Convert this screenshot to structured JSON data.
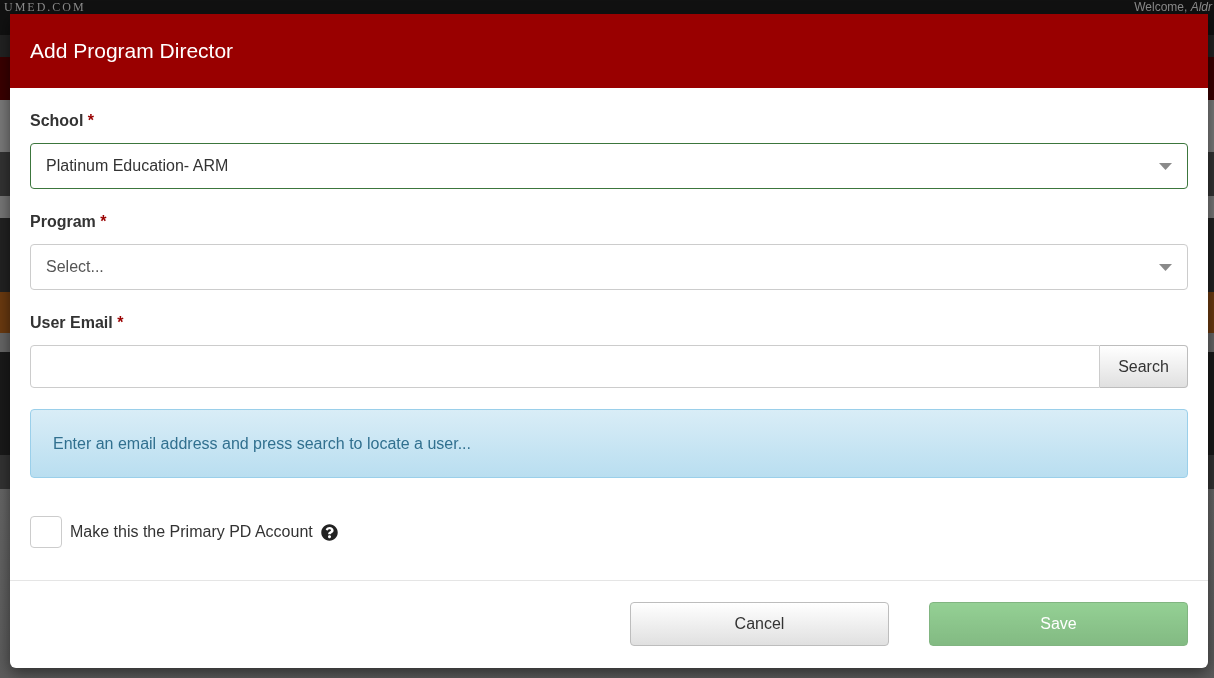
{
  "background": {
    "logo": "UMED.COM",
    "welcome": "Welcome, *Aldr*"
  },
  "dialog": {
    "title": "Add Program Director",
    "fields": [
      {
        "kind": "select",
        "label": "School",
        "required_mark": "*",
        "value": "Platinum Education- ARM",
        "valid": true
      },
      {
        "kind": "select",
        "label": "Program",
        "required_mark": "*",
        "placeholder": "Select...",
        "valid": false
      },
      {
        "kind": "search",
        "label": "User Email",
        "required_mark": "*",
        "button": "Search",
        "valid": false
      }
    ],
    "info": "Enter an email address and press search to locate a user...",
    "checkbox": {
      "label": "Make this the Primary PD Account",
      "checked": false
    },
    "buttons": [
      {
        "label": "Cancel",
        "kind": "default",
        "disabled": false
      },
      {
        "label": "Save",
        "kind": "success",
        "disabled": true
      }
    ]
  }
}
